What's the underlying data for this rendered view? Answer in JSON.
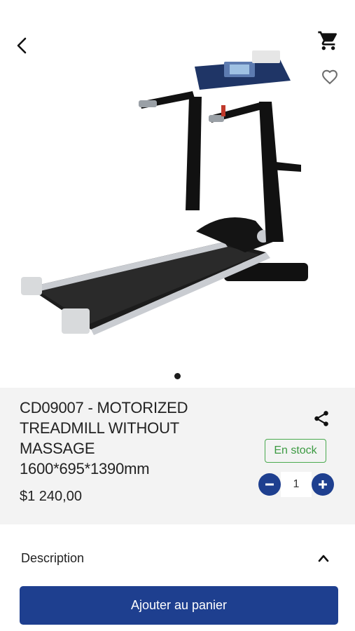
{
  "header": {
    "back_icon": "chevron-left-icon",
    "cart_icon": "cart-icon",
    "favorite_icon": "heart-outline-icon"
  },
  "gallery": {
    "image": "treadmill-product-image",
    "slide_count": 1,
    "active_slide": 1
  },
  "product": {
    "title_lines": [
      "CD09007 - MOTORIZED",
      "TREADMILL WITHOUT",
      "MASSAGE",
      "1600*695*1390mm"
    ],
    "price": "$1 240,00",
    "stock_label": "En stock",
    "quantity": "1",
    "share_icon": "share-icon"
  },
  "description": {
    "label": "Description",
    "toggle_icon": "chevron-up-icon"
  },
  "cta": {
    "label": "Ajouter au panier"
  },
  "colors": {
    "primary": "#1e3f8f",
    "stock_green": "#4aaa4f",
    "info_bg": "#f3f3f3"
  }
}
